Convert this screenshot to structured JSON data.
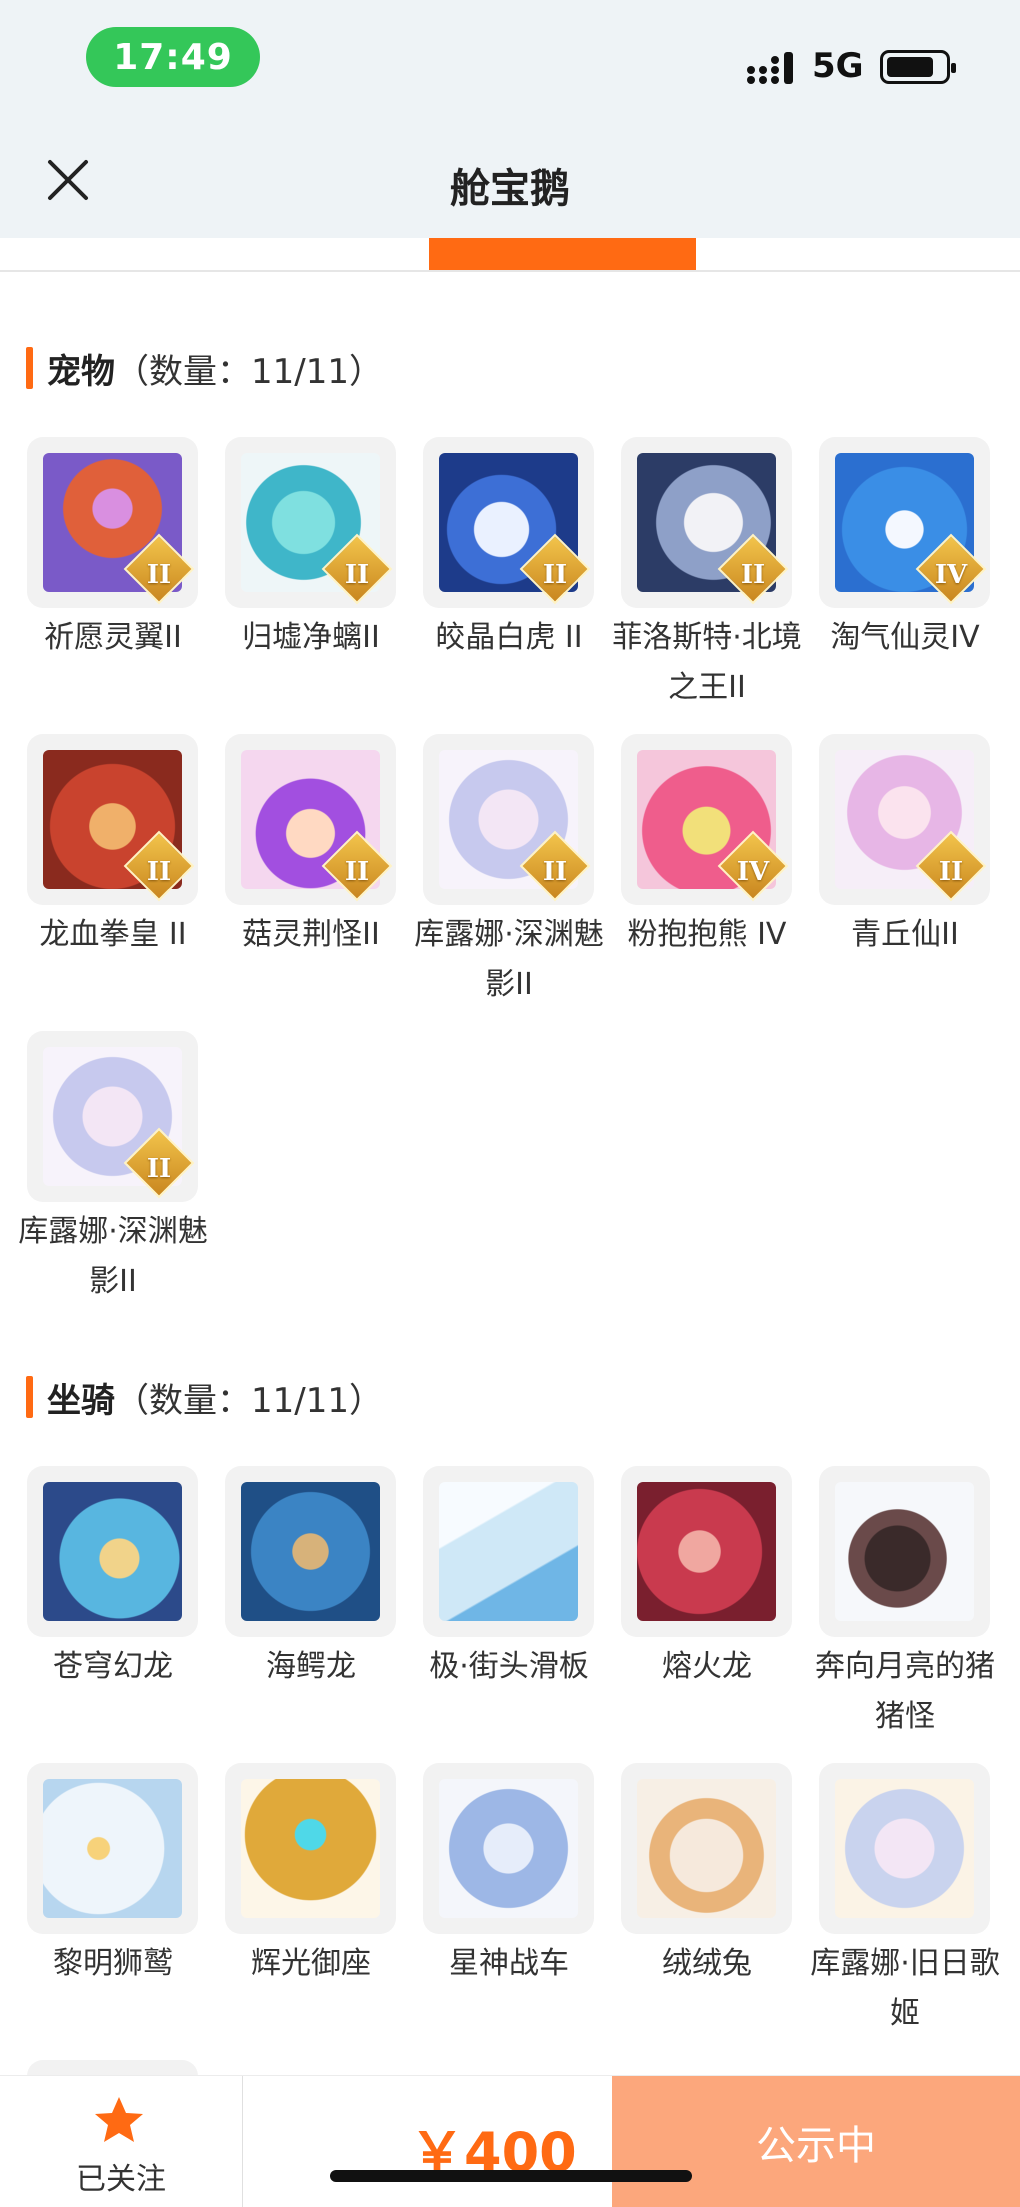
{
  "status_bar": {
    "time": "17:49",
    "network": "5G"
  },
  "header": {
    "title": "舱宝鹅"
  },
  "sections": [
    {
      "title": "宠物",
      "count": "（数量：11/11）",
      "items": [
        {
          "name": "祈愿灵翼II",
          "tier": "II",
          "icon": "phoenix-pet-icon"
        },
        {
          "name": "归墟净螭II",
          "tier": "II",
          "icon": "sea-dragon-pet-icon"
        },
        {
          "name": "皎晶白虎 II",
          "tier": "II",
          "icon": "white-tiger-pet-icon"
        },
        {
          "name": "菲洛斯特·北境之王II",
          "tier": "II",
          "icon": "north-king-pet-icon"
        },
        {
          "name": "淘气仙灵IV",
          "tier": "IV",
          "icon": "blue-puppy-pet-icon"
        },
        {
          "name": "龙血拳皇 II",
          "tier": "II",
          "icon": "red-beast-pet-icon"
        },
        {
          "name": "菇灵荆怪II",
          "tier": "II",
          "icon": "purple-sprite-pet-icon"
        },
        {
          "name": "库露娜·深渊魅影II",
          "tier": "II",
          "icon": "kuluna-pet-icon"
        },
        {
          "name": "粉抱抱熊 IV",
          "tier": "IV",
          "icon": "pink-bear-pet-icon"
        },
        {
          "name": "青丘仙II",
          "tier": "II",
          "icon": "fox-fairy-pet-icon"
        },
        {
          "name": "库露娜·深渊魅影II",
          "tier": "II",
          "icon": "kuluna-pet-icon"
        }
      ]
    },
    {
      "title": "坐骑",
      "count": "（数量：11/11）",
      "items": [
        {
          "name": "苍穹幻龙",
          "icon": "sky-dragon-mount-icon"
        },
        {
          "name": "海鳄龙",
          "icon": "sea-crocodile-dragon-mount-icon"
        },
        {
          "name": "极·街头滑板",
          "icon": "skateboard-mount-icon"
        },
        {
          "name": "熔火龙",
          "icon": "lava-dragon-mount-icon"
        },
        {
          "name": "奔向月亮的猪猪怪",
          "icon": "moon-pig-mount-icon"
        },
        {
          "name": "黎明狮鹫",
          "icon": "griffin-mount-icon"
        },
        {
          "name": "辉光御座",
          "icon": "golden-throne-mount-icon"
        },
        {
          "name": "星神战车",
          "icon": "star-horse-mount-icon"
        },
        {
          "name": "绒绒兔",
          "icon": "fluffy-rabbit-mount-icon"
        },
        {
          "name": "库露娜·旧日歌姬",
          "icon": "kuluna-singer-mount-icon"
        }
      ]
    }
  ],
  "bottom_bar": {
    "follow_label": "已关注",
    "price": "￥400",
    "status_label": "公示中"
  },
  "colors": {
    "accent": "#ff6a13",
    "status_button": "#fca77c",
    "time_pill": "#34c759",
    "star": "#ff6a13"
  }
}
